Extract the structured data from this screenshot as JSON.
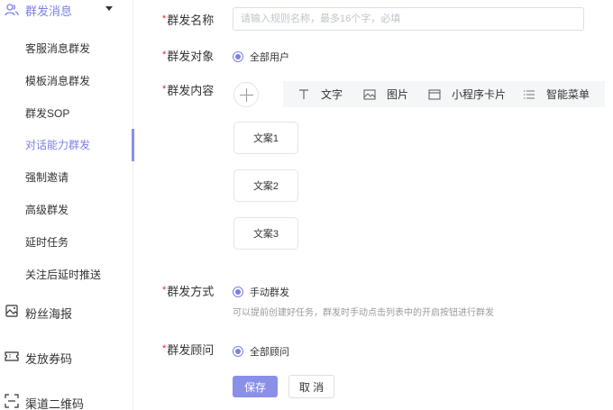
{
  "sidebar": {
    "group": {
      "label": "群发消息",
      "icon": "users-icon",
      "caret": "caret-down-icon",
      "accent": "#7b80e6"
    },
    "sub_items": [
      {
        "label": "客服消息群发"
      },
      {
        "label": "模板消息群发"
      },
      {
        "label": "群发SOP"
      },
      {
        "label": "对话能力群发",
        "active": true
      },
      {
        "label": "强制邀请"
      },
      {
        "label": "高级群发"
      },
      {
        "label": "延时任务"
      },
      {
        "label": "关注后延时推送"
      }
    ],
    "main_items": [
      {
        "label": "粉丝海报",
        "icon": "poster-icon"
      },
      {
        "label": "发放券码",
        "icon": "ticket-icon"
      },
      {
        "label": "渠道二维码",
        "icon": "qr-scan-icon"
      }
    ]
  },
  "form": {
    "required_mark": "*",
    "name": {
      "label": "群发名称",
      "placeholder": "请输入规则名称，最多16个字，必填",
      "value": ""
    },
    "target": {
      "label": "群发对象",
      "option": "全部用户"
    },
    "content": {
      "label": "群发内容",
      "tools": [
        {
          "label": "文字",
          "icon": "text-icon"
        },
        {
          "label": "图片",
          "icon": "image-icon"
        },
        {
          "label": "小程序卡片",
          "icon": "card-icon"
        },
        {
          "label": "智能菜单",
          "icon": "list-menu-icon"
        }
      ],
      "cards": [
        "文案1",
        "文案2",
        "文案3"
      ]
    },
    "method": {
      "label": "群发方式",
      "option": "手动群发",
      "hint": "可以提前创建好任务，群发时手动点击列表中的开启按钮进行群发"
    },
    "advisor": {
      "label": "群发顾问",
      "option": "全部顾问"
    },
    "save_label": "保存",
    "cancel_label": "取 消"
  },
  "colors": {
    "primary": "#8a8fe8",
    "required": "#f5222d",
    "toolbar_bg": "#f5f6f8"
  }
}
